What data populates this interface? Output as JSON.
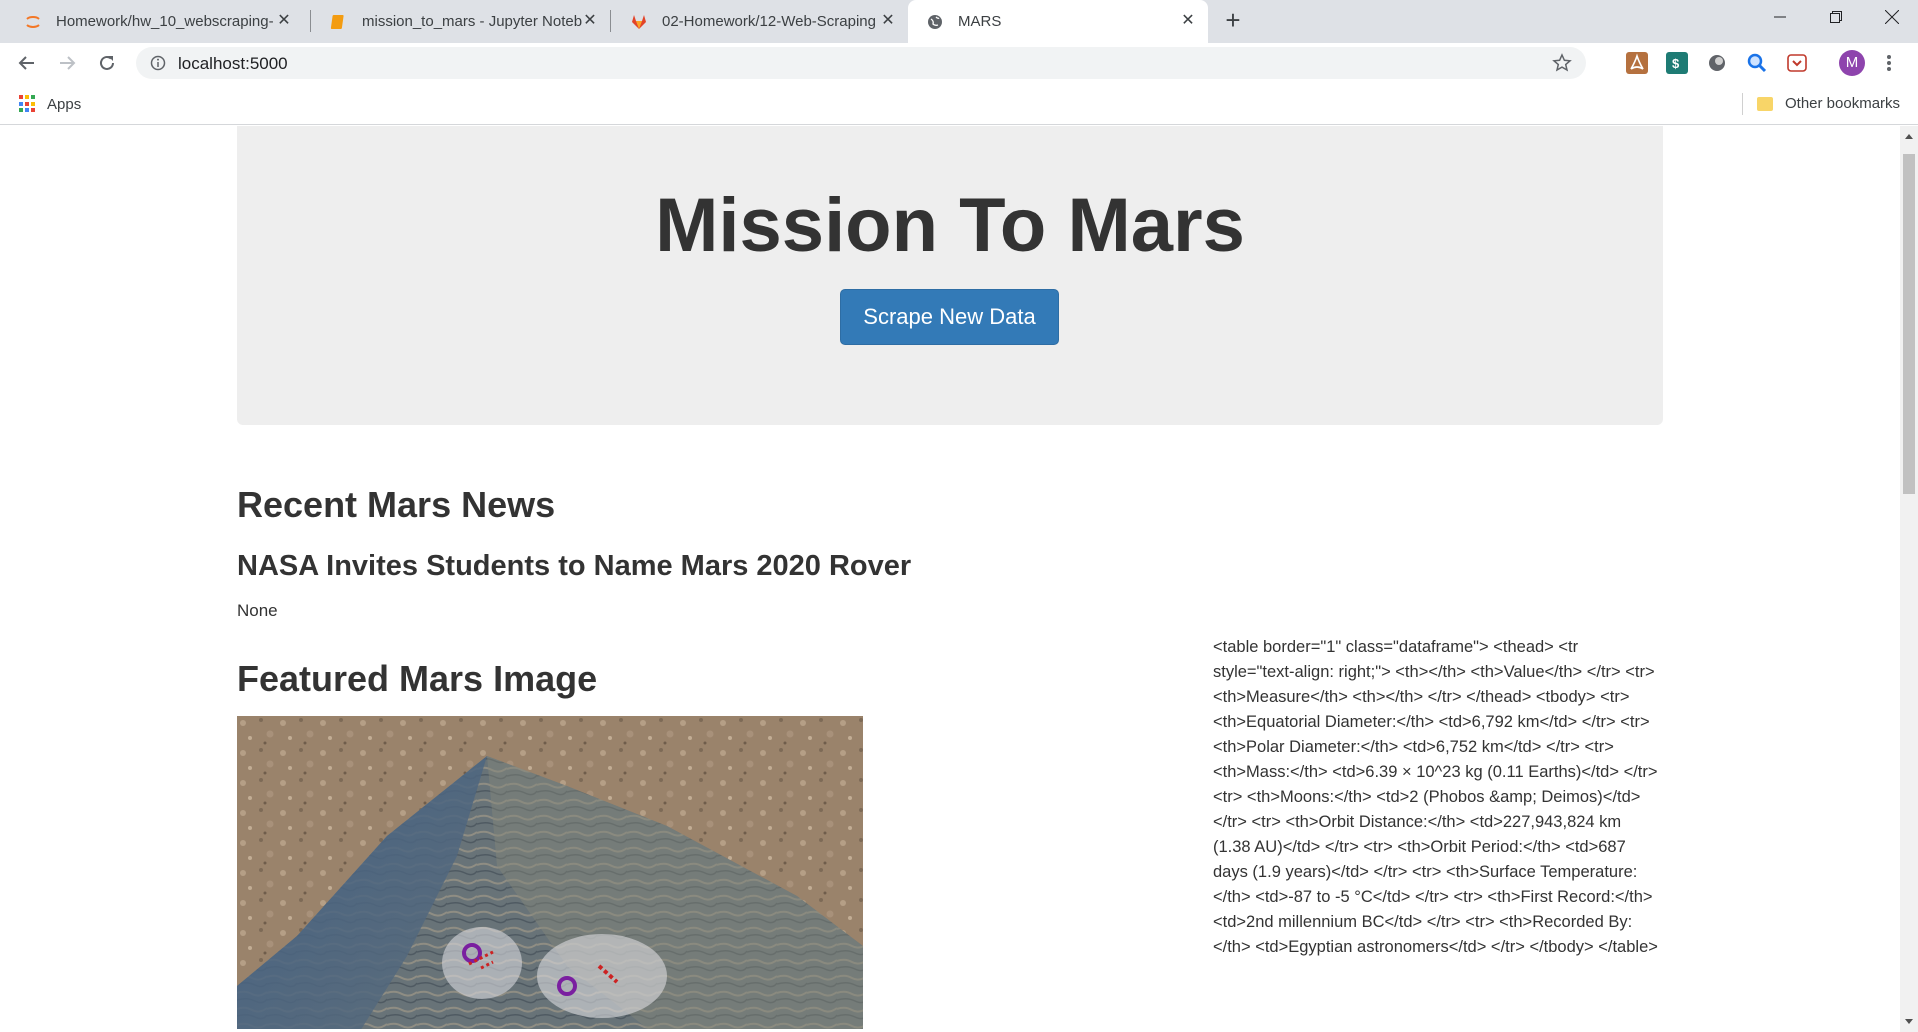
{
  "browser": {
    "tabs": [
      {
        "title": "Homework/hw_10_webscraping-",
        "icon": "jupyter-icon"
      },
      {
        "title": "mission_to_mars - Jupyter Noteb",
        "icon": "notebook-icon"
      },
      {
        "title": "02-Homework/12-Web-Scraping",
        "icon": "gitlab-icon"
      },
      {
        "title": "MARS",
        "icon": "globe-icon"
      }
    ],
    "url": "localhost:5000",
    "profile_initial": "M",
    "bookmarks": {
      "apps_label": "Apps",
      "other_label": "Other bookmarks"
    }
  },
  "page": {
    "jumbotron_title": "Mission To Mars",
    "scrape_button": "Scrape New Data",
    "news_heading": "Recent Mars News",
    "news_title": "NASA Invites Students to Name Mars 2020 Rover",
    "news_paragraph": "None",
    "image_heading": "Featured Mars Image",
    "mars_facts_raw": "<table border=\"1\" class=\"dataframe\"> <thead> <tr style=\"text-align: right;\"> <th></th> <th>Value</th> </tr> <tr> <th>Measure</th> <th></th> </tr> </thead> <tbody> <tr> <th>Equatorial Diameter:</th> <td>6,792 km</td> </tr> <tr> <th>Polar Diameter:</th> <td>6,752 km</td> </tr> <tr> <th>Mass:</th> <td>6.39 × 10^23 kg (0.11 Earths)</td> </tr> <tr> <th>Moons:</th> <td>2 (Phobos &amp; Deimos)</td> </tr> <tr> <th>Orbit Distance:</th> <td>227,943,824 km (1.38 AU)</td> </tr> <tr> <th>Orbit Period:</th> <td>687 days (1.9 years)</td> </tr> <tr> <th>Surface Temperature:</th> <td>-87 to -5 °C</td> </tr> <tr> <th>First Record:</th> <td>2nd millennium BC</td> </tr> <tr> <th>Recorded By:</th> <td>Egyptian astronomers</td> </tr> </tbody> </table>"
  },
  "colors": {
    "primary_button": "#337ab7",
    "jumbotron_bg": "#eeeeee",
    "profile": "#8e44ad"
  }
}
